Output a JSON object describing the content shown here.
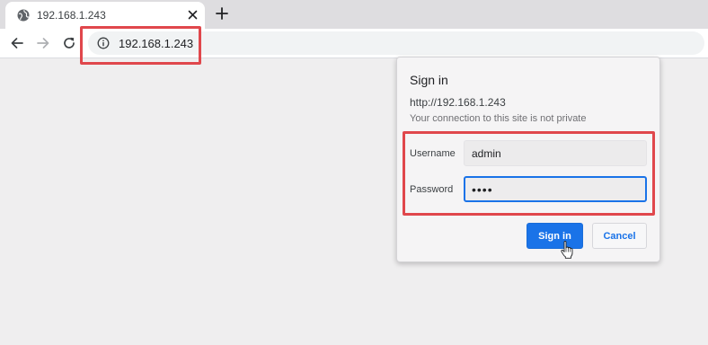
{
  "tab": {
    "title": "192.168.1.243",
    "favicon": "globe-icon",
    "close_icon": "close-icon",
    "new_tab_icon": "plus-icon"
  },
  "toolbar": {
    "back_icon": "arrow-left-icon",
    "forward_icon": "arrow-right-icon",
    "reload_icon": "reload-icon",
    "info_icon": "info-icon",
    "url": "192.168.1.243"
  },
  "dialog": {
    "title": "Sign in",
    "url": "http://192.168.1.243",
    "warning": "Your connection to this site is not private",
    "username_label": "Username",
    "username_value": "admin",
    "password_label": "Password",
    "password_value": "••••",
    "signin_label": "Sign in",
    "cancel_label": "Cancel"
  },
  "colors": {
    "accent": "#1a73e8",
    "highlight": "#e0474c",
    "page_background": "#efeeef"
  }
}
